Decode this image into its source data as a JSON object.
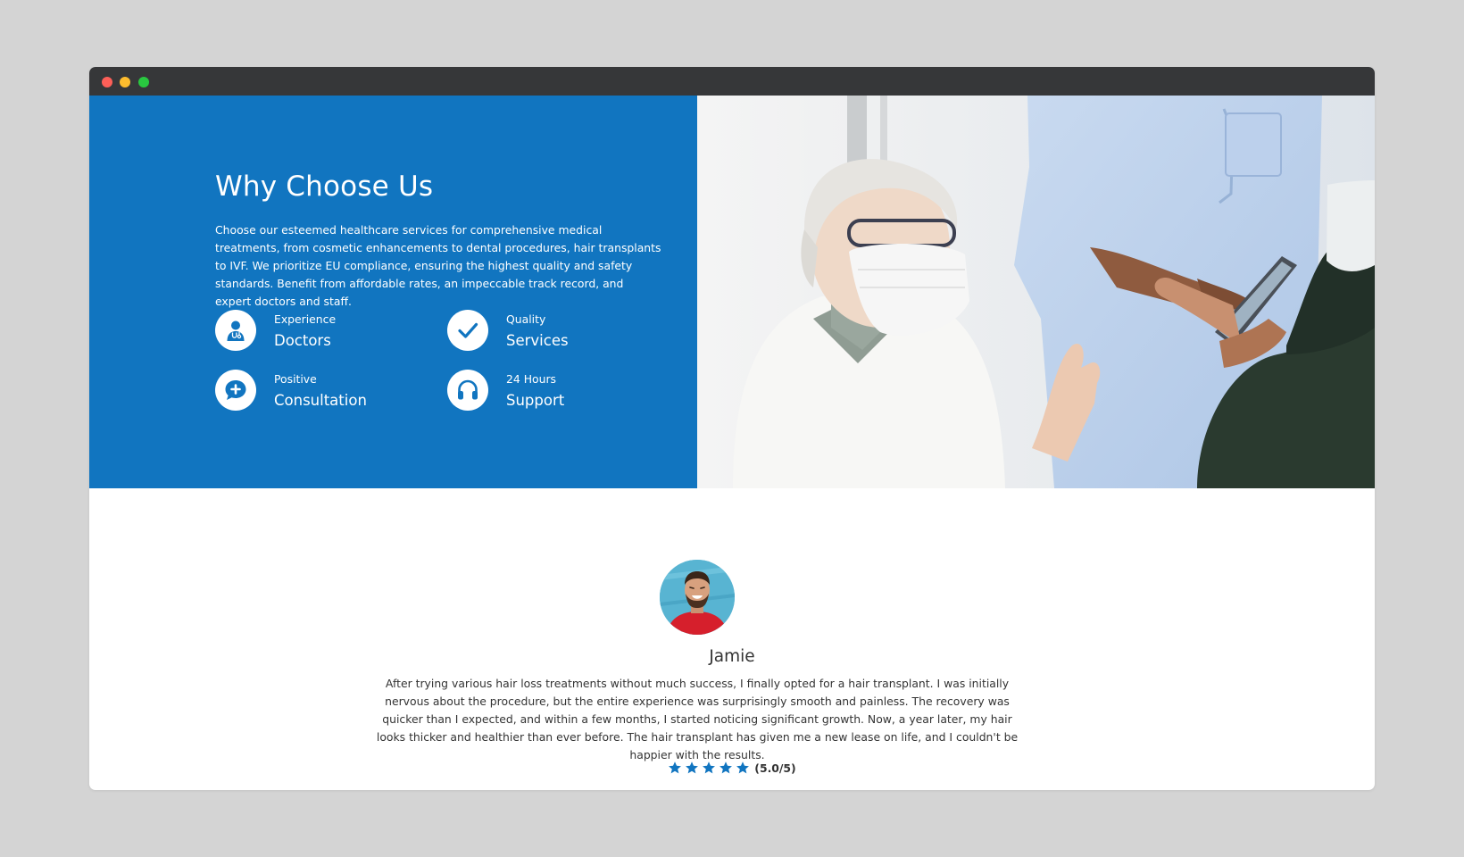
{
  "window": {
    "title": ""
  },
  "hero": {
    "title": "Why Choose Us",
    "description": "Choose our esteemed healthcare services for comprehensive medical treatments, from cosmetic enhancements to dental procedures, hair transplants to IVF. We prioritize EU compliance, ensuring the highest quality and safety standards. Benefit from affordable rates, an impeccable track record, and expert doctors and staff.",
    "accent_color": "#1175c0",
    "features": [
      {
        "small": "Experience",
        "big": "Doctors",
        "icon": "doctor-icon"
      },
      {
        "small": "Quality",
        "big": "Services",
        "icon": "checkmark-icon"
      },
      {
        "small": "Positive",
        "big": "Consultation",
        "icon": "chat-plus-icon"
      },
      {
        "small": "24 Hours",
        "big": "Support",
        "icon": "headphones-icon"
      }
    ],
    "image": "doctors consulting photo"
  },
  "testimonial": {
    "name": "Jamie",
    "text": "After trying various hair loss treatments without much success, I finally opted for a hair transplant. I was initially nervous about the procedure, but the entire experience was surprisingly smooth and painless. The recovery was quicker than I expected, and within a few months, I started noticing significant growth. Now, a year later, my hair looks thicker and healthier than ever before. The hair transplant has given me a new lease on life, and I couldn't be happier with the results.",
    "stars": 5,
    "rating_text": "(5.0/5)",
    "star_color": "#1175c0"
  }
}
